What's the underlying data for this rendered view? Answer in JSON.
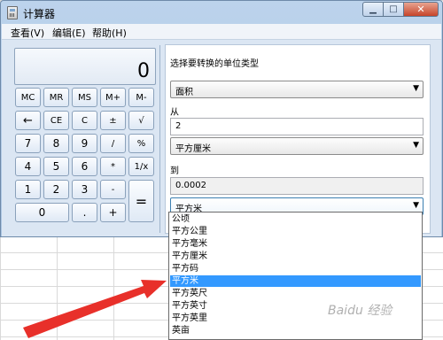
{
  "window": {
    "title": "计算器",
    "menu": [
      "查看(V)",
      "编辑(E)",
      "帮助(H)"
    ]
  },
  "display": {
    "value": "0"
  },
  "keys": {
    "mc": "MC",
    "mr": "MR",
    "ms": "MS",
    "mplus": "M+",
    "mminus": "M-",
    "back": "←",
    "ce": "CE",
    "c": "C",
    "plusminus": "±",
    "sqrt": "√",
    "seven": "7",
    "eight": "8",
    "nine": "9",
    "divide": "/",
    "percent": "%",
    "four": "4",
    "five": "5",
    "six": "6",
    "multiply": "*",
    "reciprocal": "1/x",
    "one": "1",
    "two": "2",
    "three": "3",
    "minus": "-",
    "zero": "0",
    "dot": ".",
    "plus": "+",
    "equals": "="
  },
  "converter": {
    "heading": "选择要转换的单位类型",
    "unit_type": "面积",
    "from_label": "从",
    "from_value": "2",
    "from_unit": "平方厘米",
    "to_label": "到",
    "to_value": "0.0002",
    "to_unit": "平方米",
    "options": [
      "公顷",
      "平方公里",
      "平方毫米",
      "平方厘米",
      "平方码",
      "平方米",
      "平方英尺",
      "平方英寸",
      "平方英里",
      "英亩"
    ],
    "selected_option": "平方米"
  },
  "annotation": {
    "arrow_color": "#e8302a"
  },
  "watermark": "Baidu 经验"
}
